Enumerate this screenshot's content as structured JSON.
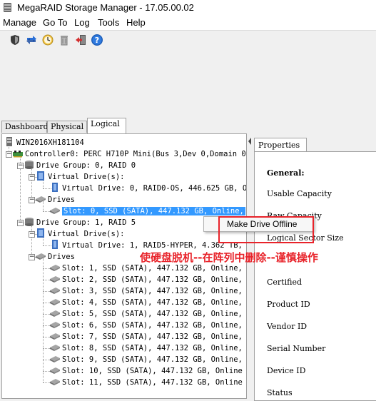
{
  "window": {
    "title": "MegaRAID Storage Manager - 17.05.00.02"
  },
  "menu": [
    "Manage",
    "Go To",
    "Log",
    "Tools",
    "Help"
  ],
  "toolbar": {
    "buttons": [
      {
        "name": "shield-icon"
      },
      {
        "name": "refresh-arrows-icon"
      },
      {
        "name": "clock-icon"
      },
      {
        "name": "trash-icon"
      },
      {
        "name": "exit-icon"
      },
      {
        "name": "help-icon"
      }
    ]
  },
  "tabs": [
    "Dashboard",
    "Physical",
    "Logical"
  ],
  "active_tab": "Logical",
  "tree": {
    "server": "WIN2016XH181104",
    "controller": "Controller0: PERC H710P Mini(Bus 3,Dev 0,Domain 0)",
    "group0": {
      "label": "Drive Group: 0, RAID  0",
      "vd_header": "Virtual Drive(s):",
      "vd": "Virtual Drive: 0, RAID0-OS, 446.625 GB, O",
      "drives_header": "Drives",
      "slots": [
        "Slot: 0, SSD  (SATA), 447.132 GB, Online,"
      ]
    },
    "group1": {
      "label": "Drive Group: 1, RAID  5",
      "vd_header": "Virtual Drive(s):",
      "vd": "Virtual Drive: 1, RAID5-HYPER, 4.362 TB,",
      "drives_header": "Drives",
      "slots": [
        "Slot: 1, SSD  (SATA), 447.132 GB, Online,",
        "Slot: 2, SSD  (SATA), 447.132 GB, Online,",
        "Slot: 3, SSD  (SATA), 447.132 GB, Online,",
        "Slot: 4, SSD  (SATA), 447.132 GB, Online,",
        "Slot: 5, SSD  (SATA), 447.132 GB, Online,",
        "Slot: 6, SSD  (SATA), 447.132 GB, Online,",
        "Slot: 7, SSD  (SATA), 447.132 GB, Online,",
        "Slot: 8, SSD  (SATA), 447.132 GB, Online,",
        "Slot: 9, SSD  (SATA), 447.132 GB, Online,",
        "Slot: 10, SSD  (SATA), 447.132 GB, Online",
        "Slot: 11, SSD  (SATA), 447.132 GB, Online"
      ]
    }
  },
  "properties": {
    "tab": "Properties",
    "section": "General:",
    "labels": [
      "Usable Capacity",
      "Raw Capacity",
      "Logical Sector Size",
      "Certified",
      "Product ID",
      "Vendor ID",
      "Serial Number",
      "Device ID",
      "Status"
    ]
  },
  "context_menu": {
    "item": "Make Drive Offline"
  },
  "annotation": {
    "text": "使硬盘脱机--在阵列中删除--谨慎操作"
  },
  "colors": {
    "selection": "#3399ff",
    "annotation": "#e8232a"
  }
}
